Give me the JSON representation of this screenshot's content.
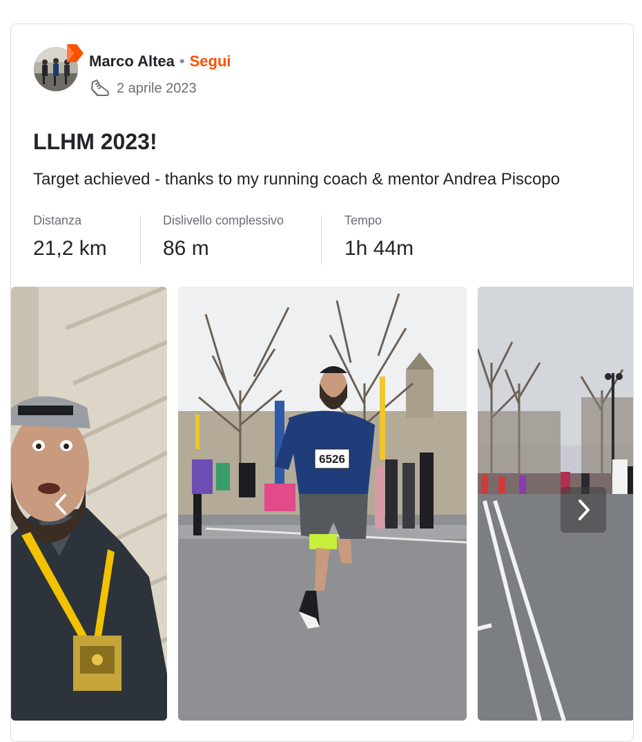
{
  "athlete": {
    "name": "Marco Altea",
    "follow_label": "Segui",
    "date": "2 aprile 2023",
    "avatar_icon": "avatar-photo",
    "badge_icon": "strava-chevron-icon"
  },
  "activity": {
    "sport_icon": "running-shoe-icon",
    "title": "LLHM 2023!",
    "description": "Target achieved - thanks to my running coach & mentor Andrea Piscopo"
  },
  "stats": [
    {
      "label": "Distanza",
      "value": "21,2 km"
    },
    {
      "label": "Dislivello complessivo",
      "value": "86 m"
    },
    {
      "label": "Tempo",
      "value": "1h 44m"
    }
  ],
  "photos": {
    "items": [
      {
        "alt": "selfie-with-medal"
      },
      {
        "alt": "runner-bib-6526",
        "bib": "6526"
      },
      {
        "alt": "race-road-with-runners"
      }
    ],
    "prev_icon": "chevron-left-icon",
    "next_icon": "chevron-right-icon"
  },
  "colors": {
    "accent": "#fc5200",
    "text": "#242428",
    "muted": "#6d6d78",
    "border": "#dcdcdc"
  }
}
